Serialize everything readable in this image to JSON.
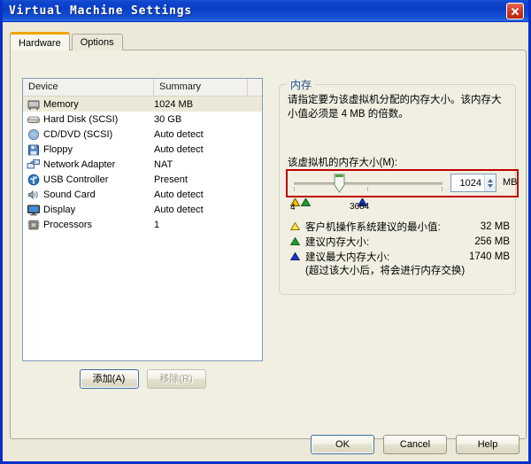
{
  "window": {
    "title": "Virtual Machine Settings",
    "close_label": "×"
  },
  "tabs": [
    {
      "label": "Hardware",
      "active": true
    },
    {
      "label": "Options",
      "active": false
    }
  ],
  "device_list": {
    "columns": [
      "Device",
      "Summary"
    ],
    "rows": [
      {
        "device": "Memory",
        "summary": "1024 MB",
        "icon": "memory-icon",
        "selected": true
      },
      {
        "device": "Hard Disk (SCSI)",
        "summary": "30 GB",
        "icon": "harddisk-icon",
        "selected": false
      },
      {
        "device": "CD/DVD (SCSI)",
        "summary": "Auto detect",
        "icon": "cddvd-icon",
        "selected": false
      },
      {
        "device": "Floppy",
        "summary": "Auto detect",
        "icon": "floppy-icon",
        "selected": false
      },
      {
        "device": "Network Adapter",
        "summary": "NAT",
        "icon": "network-adapter-icon",
        "selected": false
      },
      {
        "device": "USB Controller",
        "summary": "Present",
        "icon": "usb-icon",
        "selected": false
      },
      {
        "device": "Sound Card",
        "summary": "Auto detect",
        "icon": "sound-card-icon",
        "selected": false
      },
      {
        "device": "Display",
        "summary": "Auto detect",
        "icon": "display-icon",
        "selected": false
      },
      {
        "device": "Processors",
        "summary": "1",
        "icon": "processor-icon",
        "selected": false
      }
    ]
  },
  "list_buttons": {
    "add": "添加(A)",
    "remove": "移除(R)"
  },
  "memory_panel": {
    "group_title": "内存",
    "description": "请指定要为该虚拟机分配的内存大小。该内存大小值必须是 4 MB 的倍数。",
    "field_label": "该虚拟机的内存大小(M):",
    "value": "1024",
    "unit": "MB",
    "slider": {
      "min_tick_label": "4",
      "max_tick_label": "3684",
      "min": 4,
      "max": 3684,
      "current": 1024,
      "markers": [
        {
          "name": "guest-os-minimum-marker",
          "color": "#f2c200",
          "value": 32
        },
        {
          "name": "recommended-memory-marker",
          "color": "#1f9b2f",
          "value": 256
        },
        {
          "name": "recommended-maximum-marker",
          "color": "#1d36c8",
          "value": 1740
        }
      ]
    },
    "recommendations": [
      {
        "label": "客户机操作系统建议的最小值:",
        "value": "32 MB",
        "color": "#f2c200"
      },
      {
        "label": "建议内存大小:",
        "value": "256 MB",
        "color": "#1f9b2f"
      },
      {
        "label": "建议最大内存大小:",
        "value": "1740 MB",
        "color": "#1d36c8"
      }
    ],
    "swap_note": "(超过该大小后，将会进行内存交换)"
  },
  "dialog_buttons": {
    "ok": "OK",
    "cancel": "Cancel",
    "help": "Help"
  },
  "colors": {
    "titlebar": "#0a3ec6",
    "dialog_bg": "#ece9d8",
    "panel_bg": "#f1efe2",
    "highlight_box": "#c00000",
    "group_title": "#1d4f91",
    "selection": "#ece9d8",
    "tab_accent": "#f0a500"
  }
}
